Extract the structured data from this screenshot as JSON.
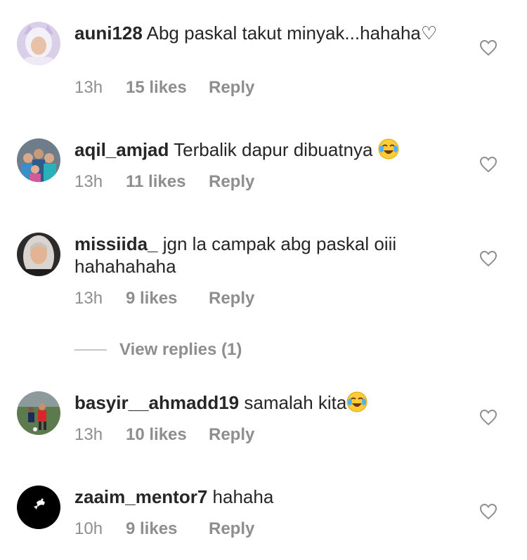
{
  "comments": [
    {
      "username": "auni128",
      "text": "Abg paskal takut minyak...hahaha♡",
      "time": "13h",
      "likes": "15 likes",
      "reply": "Reply",
      "emoji": ""
    },
    {
      "username": "aqil_amjad",
      "text": "Terbalik dapur dibuatnya",
      "time": "13h",
      "likes": "11 likes",
      "reply": "Reply",
      "emoji": "😂"
    },
    {
      "username": "missiida_",
      "text": "jgn la campak abg paskal oiii hahahahaha",
      "time": "13h",
      "likes": "9 likes",
      "reply": "Reply",
      "emoji": ""
    },
    {
      "username": "basyir__ahmadd19",
      "text": "samalah kita",
      "time": "13h",
      "likes": "10 likes",
      "reply": "Reply",
      "emoji": "😂"
    },
    {
      "username": "zaaim_mentor7",
      "text": "hahaha",
      "time": "10h",
      "likes": "9 likes",
      "reply": "Reply",
      "emoji": ""
    }
  ],
  "view_replies": {
    "label": "View replies (1)"
  },
  "icons": {
    "like": "heart-outline-icon",
    "laugh_emoji": "face-with-tears-of-joy-icon"
  },
  "colors": {
    "text": "#262626",
    "secondary": "#8e8e8e",
    "divider": "#c7c7c7"
  }
}
